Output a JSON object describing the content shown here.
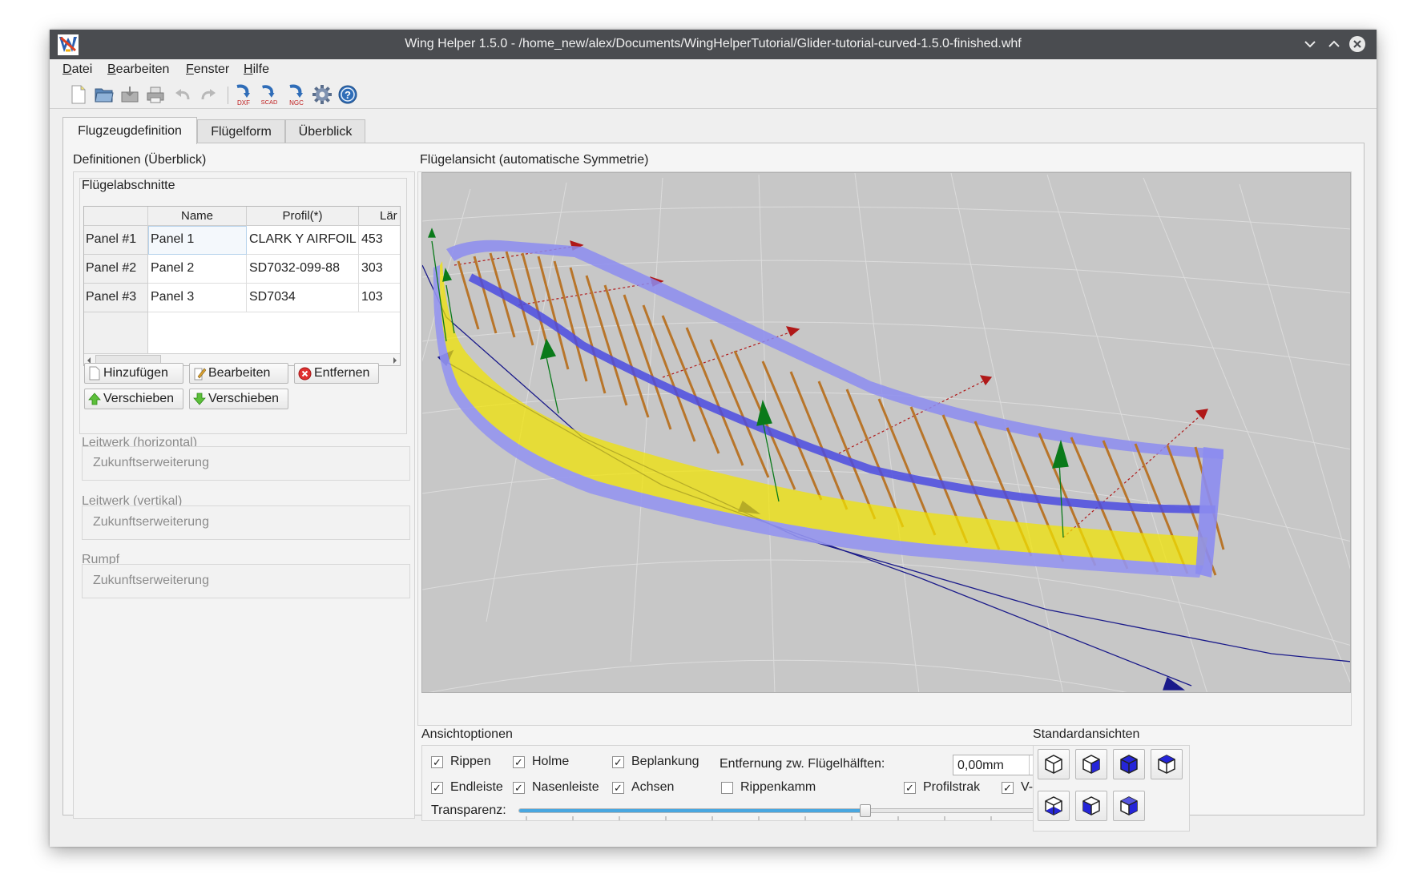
{
  "window": {
    "title": "Wing Helper 1.5.0 - /home_new/alex/Documents/WingHelperTutorial/Glider-tutorial-curved-1.5.0-finished.whf"
  },
  "menu": {
    "items": [
      {
        "label": "Datei",
        "mnemonic": "D",
        "rest": "atei"
      },
      {
        "label": "Bearbeiten",
        "mnemonic": "B",
        "rest": "earbeiten"
      },
      {
        "label": "Fenster",
        "mnemonic": "F",
        "rest": "enster"
      },
      {
        "label": "Hilfe",
        "mnemonic": "H",
        "rest": "ilfe"
      }
    ]
  },
  "toolbar": {
    "icons": [
      "new-file-icon",
      "open-file-icon",
      "save-file-icon",
      "print-icon",
      "undo-icon",
      "redo-icon",
      "export-dxf-icon",
      "export-scad-icon",
      "export-ngc-icon",
      "settings-gear-icon",
      "help-icon"
    ],
    "export_labels": {
      "dxf": "DXF",
      "scad": "SCAD",
      "ngc": "NGC"
    }
  },
  "tabs": [
    {
      "label": "Flugzeugdefinition",
      "active": true
    },
    {
      "label": "Flügelform",
      "active": false
    },
    {
      "label": "Überblick",
      "active": false
    }
  ],
  "left": {
    "heading": "Definitionen (Überblick)",
    "sections_heading": "Flügelabschnitte",
    "table": {
      "columns": [
        "Name",
        "Profil(*)",
        "Lär"
      ],
      "rows": [
        {
          "header": "Panel #1",
          "name": "Panel 1",
          "profile": "CLARK Y AIRFOIL",
          "length": "453"
        },
        {
          "header": "Panel #2",
          "name": "Panel 2",
          "profile": "SD7032-099-88",
          "length": "303"
        },
        {
          "header": "Panel #3",
          "name": "Panel 3",
          "profile": "SD7034",
          "length": "103"
        }
      ]
    },
    "buttons": {
      "add": "Hinzufügen",
      "edit": "Bearbeiten",
      "remove": "Entfernen",
      "move_up": "Verschieben",
      "move_down": "Verschieben"
    },
    "tail_horizontal": {
      "label": "Leitwerk (horizontal)",
      "content": "Zukunftserweiterung"
    },
    "tail_vertical": {
      "label": "Leitwerk (vertikal)",
      "content": "Zukunftserweiterung"
    },
    "fuselage": {
      "label": "Rumpf",
      "content": "Zukunftserweiterung"
    }
  },
  "view": {
    "heading": "Flügelansicht (automatische Symmetrie)",
    "colors": {
      "skin": "#f0e000",
      "outline": "#8c8cf0",
      "ribs": "#b8752a",
      "spar": "#5a5ae0",
      "axis_green": "#0a7a1a",
      "axis_red": "#b01010",
      "axis_blue": "#101080"
    }
  },
  "options": {
    "heading": "Ansichtoptionen",
    "checkboxes": [
      {
        "label": "Rippen",
        "checked": true
      },
      {
        "label": "Holme",
        "checked": true
      },
      {
        "label": "Beplankung",
        "checked": true
      },
      {
        "label": "Endleiste",
        "checked": true
      },
      {
        "label": "Nasenleiste",
        "checked": true
      },
      {
        "label": "Achsen",
        "checked": true
      },
      {
        "label": "Rippenkamm",
        "checked": false
      },
      {
        "label": "Profilstrak",
        "checked": true
      },
      {
        "label": "V-Stellung",
        "checked": true
      }
    ],
    "distance_label": "Entfernung zw. Flügelhälften:",
    "distance_value": "0,00mm",
    "transparency_label": "Transparenz:",
    "transparency_fraction": 0.61,
    "checkmark": "✓"
  },
  "standard_views": {
    "heading": "Standardansichten",
    "icons": [
      "view-front-icon",
      "view-back-icon",
      "view-top-icon",
      "view-bottom-icon",
      "view-left-icon",
      "view-right-icon",
      "view-iso-icon"
    ]
  }
}
